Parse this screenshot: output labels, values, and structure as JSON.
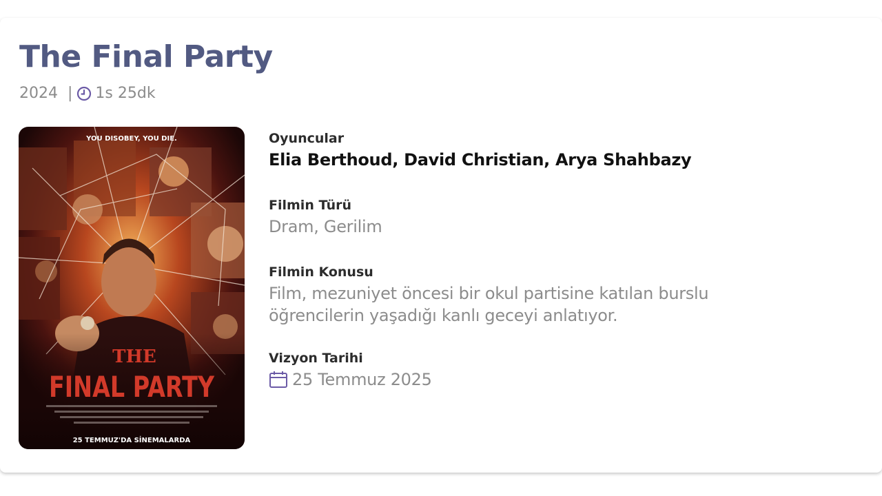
{
  "movie": {
    "title": "The Final Party",
    "year": "2024",
    "separator": "|",
    "duration": "1s 25dk",
    "clock_icon": "clock-icon",
    "calendar_icon": "calendar-icon"
  },
  "poster": {
    "tagline": "YOU DISOBEY, YOU DIE.",
    "title_line1": "THE",
    "title_line2": "FINAL PARTY",
    "release_text": "25 TEMMUZ'DA SİNEMALARDA"
  },
  "details": {
    "cast_label": "Oyuncular",
    "cast_value": "Elia Berthoud, David Christian, Arya Shahbazy",
    "genre_label": "Filmin Türü",
    "genre_value": "Dram, Gerilim",
    "plot_label": "Filmin Konusu",
    "plot_value": "Film, mezuniyet öncesi bir okul partisine katılan burslu öğrencilerin yaşadığı kanlı geceyi anlatıyor.",
    "release_label": "Vizyon Tarihi",
    "release_value": "25 Temmuz 2025"
  },
  "colors": {
    "title": "#525a82",
    "accent_icon": "#6b5aa6",
    "muted_text": "#8c8c8c"
  }
}
